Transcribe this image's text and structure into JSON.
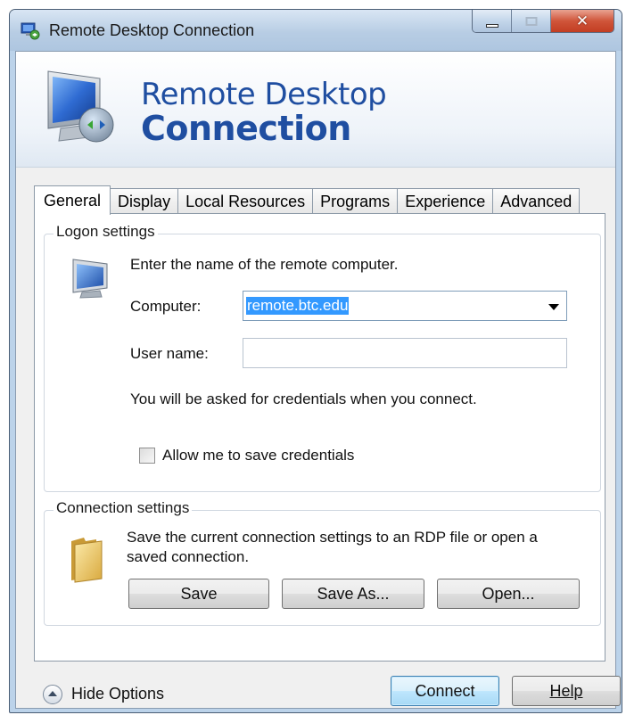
{
  "window": {
    "title": "Remote Desktop Connection"
  },
  "banner": {
    "line1": "Remote Desktop",
    "line2": "Connection"
  },
  "tabs": [
    {
      "label": "General",
      "active": true
    },
    {
      "label": "Display",
      "active": false
    },
    {
      "label": "Local Resources",
      "active": false
    },
    {
      "label": "Programs",
      "active": false
    },
    {
      "label": "Experience",
      "active": false
    },
    {
      "label": "Advanced",
      "active": false
    }
  ],
  "logon": {
    "legend": "Logon settings",
    "instructions": "Enter the name of the remote computer.",
    "computer_label": "Computer:",
    "computer_value": "remote.btc.edu",
    "username_label": "User name:",
    "username_value": "",
    "credentials_note": "You will be asked for credentials when you connect.",
    "save_credentials_label": "Allow me to save credentials",
    "save_credentials_checked": false
  },
  "connection": {
    "legend": "Connection settings",
    "description_line1": "Save the current connection settings to an RDP file or open a",
    "description_line2": "saved connection.",
    "save_label": "Save",
    "save_as_label": "Save As...",
    "open_label": "Open..."
  },
  "footer": {
    "hide_options_label": "Hide Options",
    "connect_label": "Connect",
    "help_label": "Help"
  },
  "colors": {
    "banner_text": "#1f4ea1",
    "selection": "#3399ff",
    "close_button": "#c23d22"
  },
  "icons": [
    "remote-desktop-icon",
    "minimize-icon",
    "maximize-icon",
    "close-icon",
    "computer-icon",
    "folder-icon",
    "chevron-up-icon",
    "dropdown-arrow-icon"
  ]
}
